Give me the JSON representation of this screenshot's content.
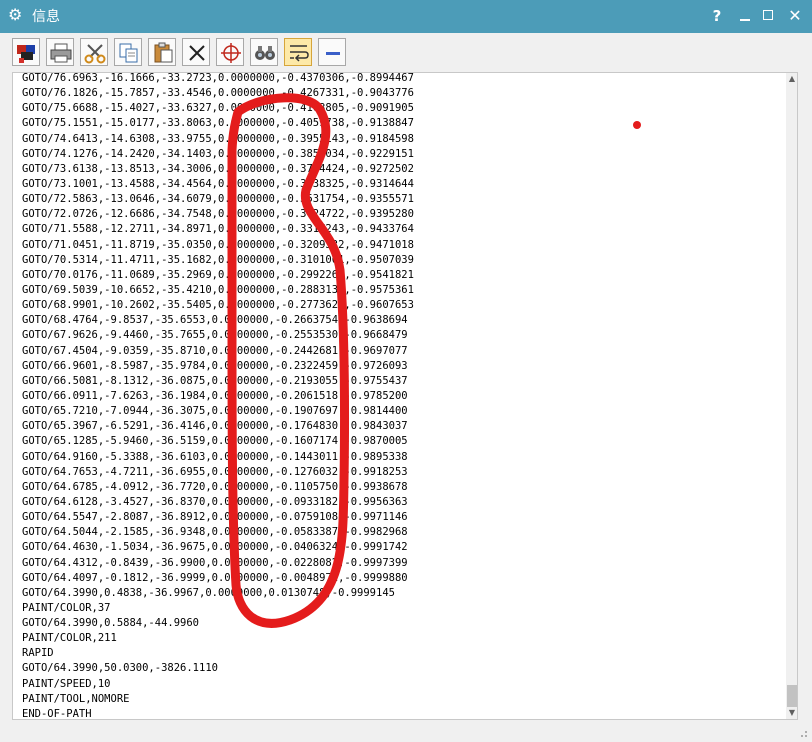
{
  "window": {
    "title": "信息",
    "gear_icon": "gear-icon",
    "help_label": "?",
    "close_glyph": "✕"
  },
  "toolbar": {
    "tools": [
      {
        "name": "toolbar-color-button",
        "icon": "color-icon"
      },
      {
        "name": "toolbar-print-button",
        "icon": "printer-icon"
      },
      {
        "name": "toolbar-cut-button",
        "icon": "scissors-icon"
      },
      {
        "name": "toolbar-copy-button",
        "icon": "copy-icon"
      },
      {
        "name": "toolbar-paste-button",
        "icon": "paste-icon"
      },
      {
        "name": "toolbar-delete-button",
        "icon": "delete-icon"
      },
      {
        "name": "toolbar-target-button",
        "icon": "crosshair-icon"
      },
      {
        "name": "toolbar-find-button",
        "icon": "binoculars-icon"
      },
      {
        "name": "toolbar-wrap-button",
        "icon": "word-wrap-icon"
      },
      {
        "name": "toolbar-collapse-button",
        "icon": "minus-icon"
      }
    ]
  },
  "content": {
    "lines": [
      "GOTO/76.6963,-16.1666,-33.2723,0.0000000,-0.4370306,-0.8994467",
      "GOTO/76.1826,-15.7857,-33.4546,0.0000000,-0.4267331,-0.9043776",
      "GOTO/75.6688,-15.4027,-33.6327,0.0000000,-0.4163805,-0.9091905",
      "GOTO/75.1551,-15.0177,-33.8063,0.0000000,-0.4059738,-0.9138847",
      "GOTO/74.6413,-14.6308,-33.9755,0.0000000,-0.3955143,-0.9184598",
      "GOTO/74.1276,-14.2420,-34.1403,0.0000000,-0.3850034,-0.9229151",
      "GOTO/73.6138,-13.8513,-34.3006,0.0000000,-0.3744424,-0.9272502",
      "GOTO/73.1001,-13.4588,-34.4564,0.0000000,-0.3638325,-0.9314644",
      "GOTO/72.5863,-13.0646,-34.6079,0.0000000,-0.3531754,-0.9355571",
      "GOTO/72.0726,-12.6686,-34.7548,0.0000000,-0.3424722,-0.9395280",
      "GOTO/71.5588,-12.2711,-34.8971,0.0000000,-0.3317243,-0.9433764",
      "GOTO/71.0451,-11.8719,-35.0350,0.0000000,-0.3209332,-0.9471018",
      "GOTO/70.5314,-11.4711,-35.1682,0.0000000,-0.3101001,-0.9507039",
      "GOTO/70.0176,-11.0689,-35.2969,0.0000000,-0.2992264,-0.9541821",
      "GOTO/69.5039,-10.6652,-35.4210,0.0000000,-0.2883135,-0.9575361",
      "GOTO/68.9901,-10.2602,-35.5405,0.0000000,-0.2773627,-0.9607653",
      "GOTO/68.4764,-9.8537,-35.6553,0.0000000,-0.2663754,-0.9638694",
      "GOTO/67.9626,-9.4460,-35.7655,0.0000000,-0.2553530,-0.9668479",
      "GOTO/67.4504,-9.0359,-35.8710,0.0000000,-0.2442681,-0.9697077",
      "GOTO/66.9601,-8.5987,-35.9784,0.0000000,-0.2322459,-0.9726093",
      "GOTO/66.5081,-8.1312,-36.0875,0.0000000,-0.2193055,-0.9755437",
      "GOTO/66.0911,-7.6263,-36.1984,0.0000000,-0.2061518,-0.9785200",
      "GOTO/65.7210,-7.0944,-36.3075,0.0000000,-0.1907697,-0.9814400",
      "GOTO/65.3967,-6.5291,-36.4146,0.0000000,-0.1764830,-0.9843037",
      "GOTO/65.1285,-5.9460,-36.5159,0.0000000,-0.1607174,-0.9870005",
      "GOTO/64.9160,-5.3388,-36.6103,0.0000000,-0.1443011,-0.9895338",
      "GOTO/64.7653,-4.7211,-36.6955,0.0000000,-0.1276032,-0.9918253",
      "GOTO/64.6785,-4.0912,-36.7720,0.0000000,-0.1105750,-0.9938678",
      "GOTO/64.6128,-3.4527,-36.8370,0.0000000,-0.0933182,-0.9956363",
      "GOTO/64.5547,-2.8087,-36.8912,0.0000000,-0.0759108,-0.9971146",
      "GOTO/64.5044,-2.1585,-36.9348,0.0000000,-0.0583387,-0.9982968",
      "GOTO/64.4630,-1.5034,-36.9675,0.0000000,-0.0406324,-0.9991742",
      "GOTO/64.4312,-0.8439,-36.9900,0.0000000,-0.0228082,-0.9997399",
      "GOTO/64.4097,-0.1812,-36.9999,0.0000000,-0.0048972,-0.9999880",
      "GOTO/64.3990,0.4838,-36.9967,0.0000000,0.0130748,-0.9999145",
      "PAINT/COLOR,37",
      "GOTO/64.3990,0.5884,-44.9960",
      "PAINT/COLOR,211",
      "RAPID",
      "GOTO/64.3990,50.0300,-3826.1110",
      "PAINT/SPEED,10",
      "PAINT/TOOL,NOMORE",
      "END-OF-PATH"
    ]
  },
  "annotation": {
    "stroke_color": "#e41c1c",
    "dot_color": "#e41c1c"
  },
  "colors": {
    "titlebar": "#4c9cb8",
    "active_tool": "#fde9a8"
  }
}
